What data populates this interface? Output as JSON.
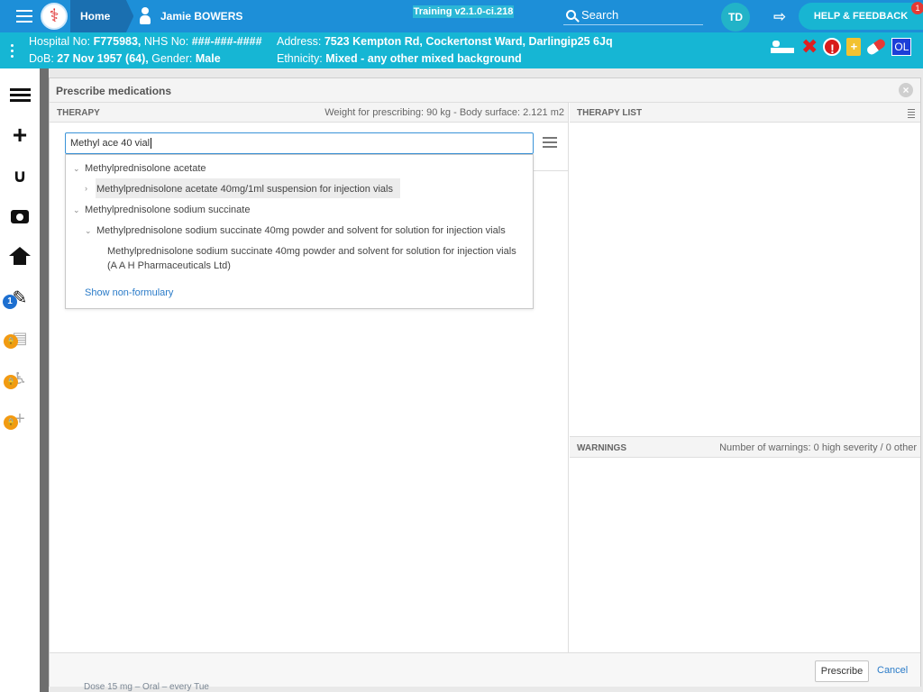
{
  "topbar": {
    "home_label": "Home",
    "patient_name": "Jamie BOWERS",
    "training": "Training v2.1.0-ci.218",
    "search_label": "Search",
    "avatar_initials": "TD",
    "help_label": "HELP & FEEDBACK",
    "help_badge": "1"
  },
  "patient_bar": {
    "hospital_label": "Hospital No:",
    "hospital_no": "F775983,",
    "nhs_label": "NHS No:",
    "nhs_no": "###-###-####",
    "address_label": "Address:",
    "address": "7523 Kempton Rd, Cockertonst Ward, Darlingip25 6Jq",
    "dob_label": "DoB:",
    "dob": "27 Nov 1957 (64),",
    "gender_label": "Gender:",
    "gender": "Male",
    "ethnicity_label": "Ethnicity:",
    "ethnicity": "Mixed - any other mixed background",
    "ol_label": "OL"
  },
  "sidebar": {
    "tasks_badge": "1",
    "lock_glyph": "🔒"
  },
  "modal": {
    "title": "Prescribe medications",
    "therapy_header": "THERAPY",
    "weight_info": "Weight for prescribing: 90 kg - Body surface: 2.121 m2",
    "search_value": "Methyl ace 40 vial",
    "therapy_list_header": "THERAPY LIST",
    "warnings_header": "WARNINGS",
    "warnings_count": "Number of warnings: 0 high severity / 0 other",
    "prescribe_label": "Prescribe",
    "cancel_label": "Cancel"
  },
  "dropdown": {
    "items": [
      {
        "label": "Methylprednisolone acetate"
      },
      {
        "label": "Methylprednisolone acetate 40mg/1ml suspension for injection vials"
      },
      {
        "label": "Methylprednisolone sodium succinate"
      },
      {
        "label": "Methylprednisolone sodium succinate 40mg powder and solvent for solution for injection vials"
      },
      {
        "label": "Methylprednisolone sodium succinate 40mg powder and solvent for solution for injection vials"
      },
      {
        "label": "(A A H Pharmaceuticals Ltd)"
      }
    ],
    "show_non_formulary": "Show non-formulary"
  },
  "background": {
    "peek_text": "Dose 15 mg – Oral – every Tue"
  }
}
